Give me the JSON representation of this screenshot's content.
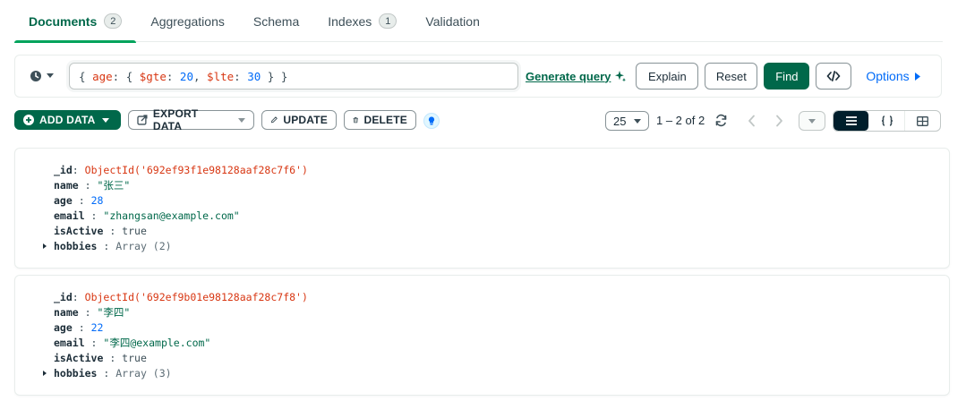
{
  "tabs": [
    {
      "label": "Documents",
      "count": "2",
      "active": true
    },
    {
      "label": "Aggregations"
    },
    {
      "label": "Schema"
    },
    {
      "label": "Indexes",
      "count": "1"
    },
    {
      "label": "Validation"
    }
  ],
  "query": {
    "open": "{ ",
    "field": "age",
    "colon_open": ": { ",
    "op1": "$gte",
    "sep1": ": ",
    "val1": "20",
    "comma": ", ",
    "op2": "$lte",
    "sep2": ": ",
    "val2": "30",
    "close": " } }"
  },
  "querybar": {
    "generate_query": "Generate query",
    "explain": "Explain",
    "reset": "Reset",
    "find": "Find",
    "options": "Options"
  },
  "toolbar": {
    "add_data": "ADD DATA",
    "export_data": "EXPORT DATA",
    "update": "UPDATE",
    "delete": "DELETE",
    "page_size": "25",
    "range": "1 – 2 of 2"
  },
  "documents": [
    {
      "id_key": "_id",
      "id_val": "ObjectId('692ef93f1e98128aaf28c7f6')",
      "name_key": "name",
      "name_val": "\"张三\"",
      "age_key": "age",
      "age_val": "28",
      "email_key": "email",
      "email_val": "\"zhangsan@example.com\"",
      "active_key": "isActive",
      "active_val": "true",
      "hobbies_key": "hobbies",
      "hobbies_val": "Array (2)"
    },
    {
      "id_key": "_id",
      "id_val": "ObjectId('692ef9b01e98128aaf28c7f8')",
      "name_key": "name",
      "name_val": "\"李四\"",
      "age_key": "age",
      "age_val": "22",
      "email_key": "email",
      "email_val": "\"李四@example.com\"",
      "active_key": "isActive",
      "active_val": "true",
      "hobbies_key": "hobbies",
      "hobbies_val": "Array (3)"
    }
  ],
  "colors": {
    "brand_green": "#00684a",
    "accent_green": "#00a35c",
    "link_blue": "#016bf8",
    "oid_red": "#d83713",
    "dark": "#001e2b"
  },
  "icons": [
    "history-clock-icon",
    "sparkle-icon",
    "code-icon",
    "caret-right-icon",
    "plus-circle-icon",
    "export-icon",
    "pencil-icon",
    "trash-icon",
    "bulb-icon",
    "refresh-icon",
    "chevron-left-icon",
    "chevron-right-icon",
    "list-view-icon",
    "json-view-icon",
    "table-view-icon"
  ]
}
